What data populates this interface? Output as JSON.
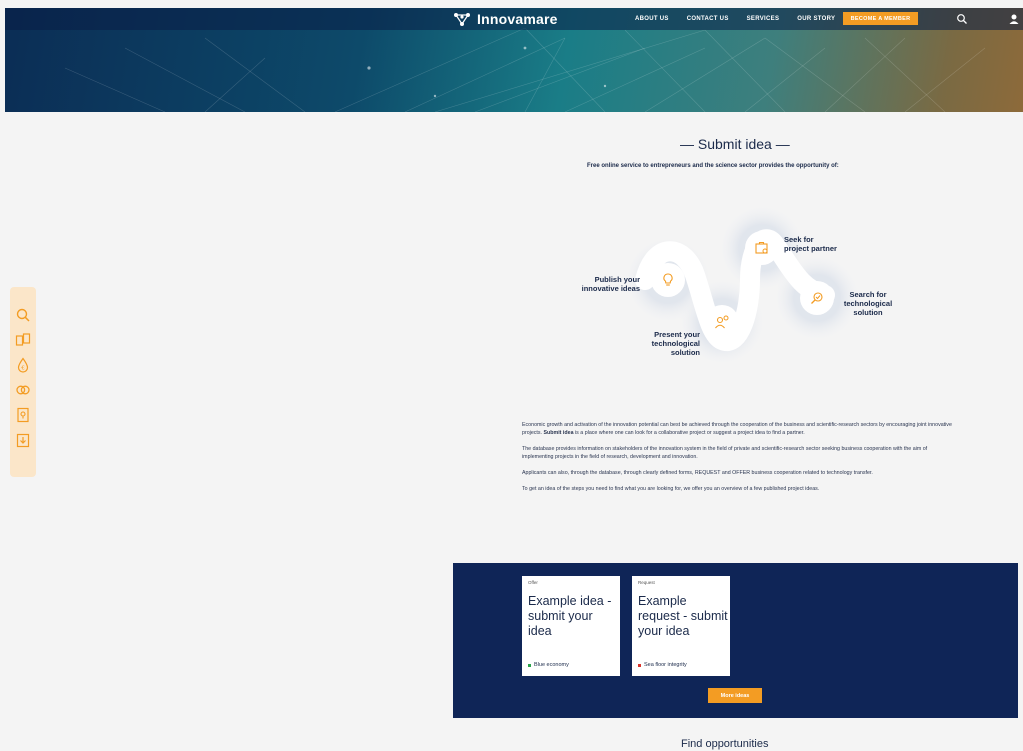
{
  "brand": {
    "name": "Innovamare"
  },
  "nav": {
    "items": [
      "ABOUT US",
      "CONTACT US",
      "SERVICES",
      "OUR STORY"
    ],
    "cta": "BECOME A MEMBER"
  },
  "section": {
    "title": "— Submit idea —",
    "subtitle": "Free online service to entrepreneurs and the science sector provides the opportunity of:"
  },
  "diagram": {
    "labels": {
      "publish_1": "Publish your",
      "publish_2": "innovative ideas",
      "seek_1": "Seek for",
      "seek_2": "project partner",
      "search_1": "Search for",
      "search_2": "technological",
      "search_3": "solution",
      "present_1": "Present your",
      "present_2": "technological",
      "present_3": "solution"
    }
  },
  "body": {
    "p1_a": "Economic growth and activation of the innovation potential can best be achieved through the cooperation of the business and scientific-research sectors by encouraging joint innovative projects. ",
    "p1_b": "Submit idea",
    "p1_c": " is a place where one can look for a collaborative project or suggest a project idea to find a partner.",
    "p2": "The database provides information on stakeholders of the innovation system in the field of private and scientific-research sector seeking business cooperation with the aim of implementing projects in the field of research, development and innovation.",
    "p3": "Applicants can also, through the database, through clearly defined forms, REQUEST and OFFER business cooperation related to technology transfer.",
    "p4": "To get an idea of the steps you need to find what you are looking for, we offer you an overview of a few published project ideas."
  },
  "cards": [
    {
      "type": "Offer",
      "title": "Example idea - submit your idea",
      "tag": "Blue economy",
      "tag_color": "#2aa34a"
    },
    {
      "type": "Request",
      "title": "Example request - submit your idea",
      "tag": "Sea floor integrity",
      "tag_color": "#d9342b"
    }
  ],
  "more_button": "More ideas",
  "find_title": "Find opportunities",
  "colors": {
    "accent": "#f39c23",
    "navy": "#0f2557",
    "text": "#1b2a4a",
    "toolbar_bg": "#fbe6c9"
  }
}
